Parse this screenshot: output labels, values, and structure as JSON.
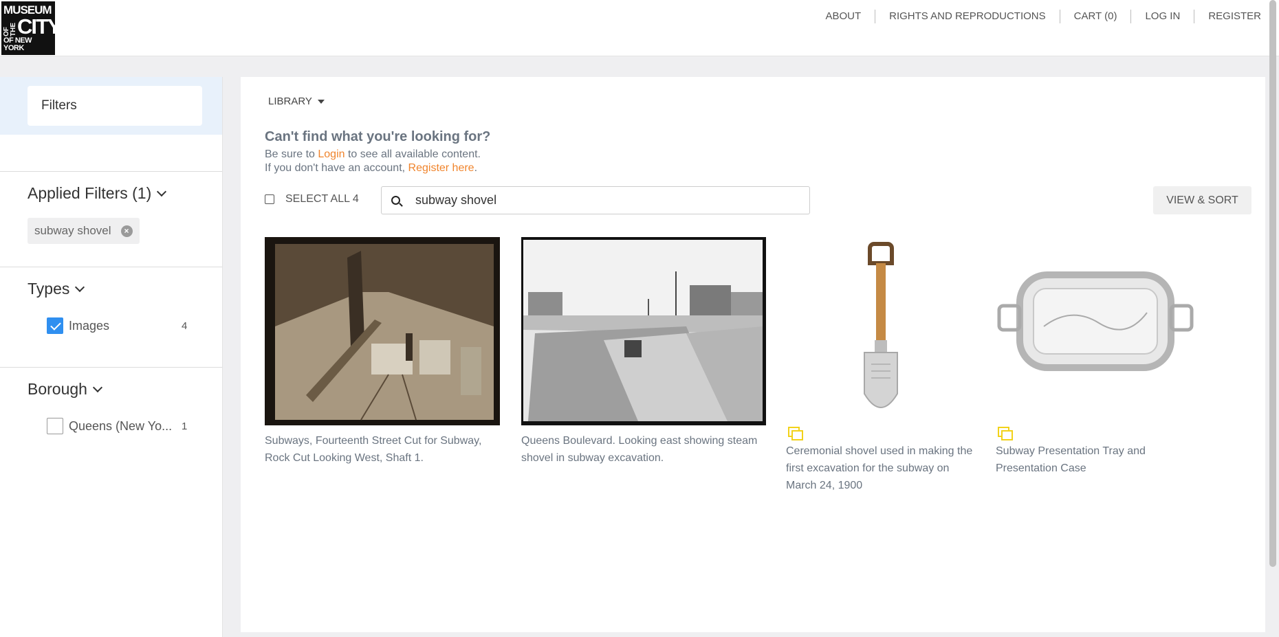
{
  "logo": {
    "line1": "MUSEUM",
    "of_the": "OF THE",
    "city": "CITY",
    "line3": "OF NEW YORK"
  },
  "nav": [
    "ABOUT",
    "RIGHTS AND REPRODUCTIONS",
    "CART (0)",
    "LOG IN",
    "REGISTER"
  ],
  "sidebar": {
    "filters_label": "Filters",
    "applied": {
      "title": "Applied Filters (1)",
      "chip": "subway shovel"
    },
    "types": {
      "title": "Types",
      "items": [
        {
          "label": "Images",
          "count": "4",
          "checked": true
        }
      ]
    },
    "borough": {
      "title": "Borough",
      "items": [
        {
          "label": "Queens (New Yo...",
          "count": "1",
          "checked": false
        }
      ]
    }
  },
  "main": {
    "library_label": "LIBRARY",
    "help_title": "Can't find what you're looking for?",
    "help_line1_pre": "Be sure to ",
    "help_line1_link": "Login",
    "help_line1_post": " to see all available content.",
    "help_line2_pre": "If you don't have an account, ",
    "help_line2_link": "Register here",
    "help_line2_post": ".",
    "select_all": "SELECT ALL 4",
    "search_value": "subway shovel",
    "view_sort": "VIEW & SORT"
  },
  "results": [
    {
      "caption": "Subways, Fourteenth Street Cut for Subway, Rock Cut Looking West, Shaft 1.",
      "image": "sepia tunnel photo"
    },
    {
      "caption": "Queens Boulevard. Looking east showing steam shovel in subway excavation.",
      "image": "black and white street excavation"
    },
    {
      "caption": "Ceremonial shovel used in making the first excavation for the subway on March 24, 1900",
      "image": "silver shovel",
      "multi": true
    },
    {
      "caption": "Subway Presentation Tray and Presentation Case",
      "image": "silver tray",
      "multi": true
    }
  ],
  "colors": {
    "accent_orange": "#f0842c",
    "checkbox_blue": "#2f8ff0",
    "multi_icon": "#f2d21a"
  }
}
